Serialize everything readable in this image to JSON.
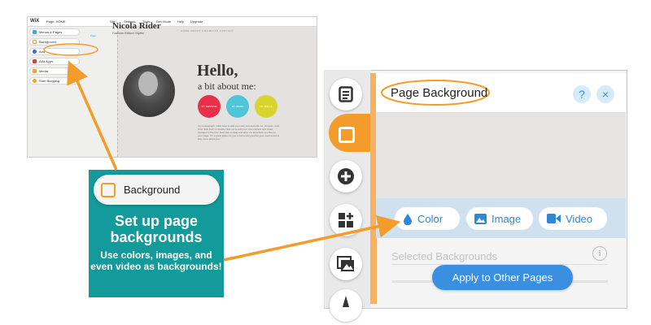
{
  "mini_editor": {
    "logo": "WiX",
    "page_label": "Page: HOME",
    "menu": [
      "Site",
      "Settings",
      "Tools",
      "Dev Mode",
      "Help",
      "Upgrade"
    ],
    "sidebar": [
      "Menus & Pages",
      "Background",
      "Add",
      "Add Apps",
      "Media",
      "Start Blogging"
    ],
    "site_name": "Nicola Rider",
    "site_role": "Fashion Editor/ Stylist",
    "site_nav": "HOME   ABOUT   PROJECTS   CONTACT",
    "page_tag": "Page",
    "hello": "Hello,",
    "about": "a bit about me:",
    "circles": [
      "MY DESIGNS",
      "MY WORK",
      "MY SKILLS"
    ],
    "paragraph": "I'm a paragraph. Click here to add your own text and edit me. It's easy. Just click \"Edit Text\" or double click me to add your own content and make changes to the font. Feel free to drag and drop me anywhere you like on your page. I'm a great place for you to tell a story and let your users know a little more about you."
  },
  "callout": {
    "pill_label": "Background",
    "title": "Set up page backgrounds",
    "body": "Use colors, images, and even video as backgrounds!"
  },
  "panel": {
    "title": "Page Background",
    "help": "?",
    "close": "×",
    "buttons": {
      "color": "Color",
      "image": "Image",
      "video": "Video"
    },
    "selected_label": "Selected Backgrounds",
    "apply": "Apply to Other Pages"
  },
  "colors": {
    "teal": "#139a9a",
    "orange": "#f39c2c",
    "blue": "#3a8fe0"
  },
  "icons": [
    "list-icon",
    "square-icon",
    "plus-icon",
    "apps-icon",
    "media-icon",
    "drop-icon",
    "image-icon",
    "video-icon",
    "info-icon"
  ]
}
